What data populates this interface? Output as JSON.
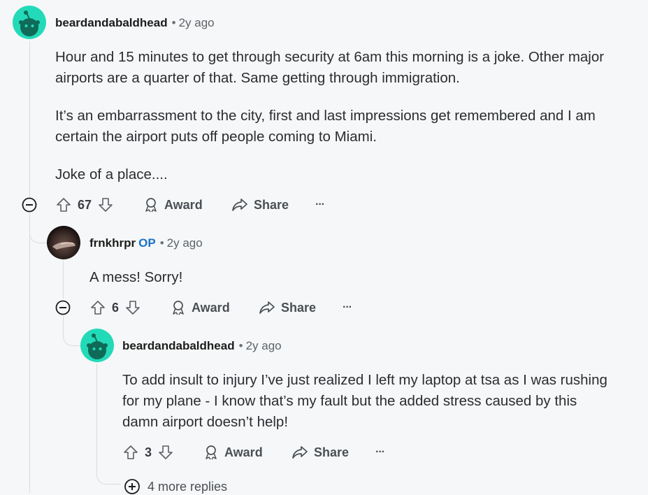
{
  "comments": [
    {
      "username": "beardandabaldhead",
      "op_badge": "",
      "separator": "•",
      "time": "2y ago",
      "paragraphs": [
        "Hour and 15 minutes to get through security at 6am this morning is a joke. Other major airports are a quarter of that. Same getting through immigration.",
        "It’s an embarrassment to the city, first and last impressions get remembered and I am certain the airport puts off people coming to Miami.",
        "Joke of a place...."
      ],
      "votes": "67",
      "award_label": "Award",
      "share_label": "Share",
      "more_label": "···"
    },
    {
      "username": "frnkhrpr",
      "op_badge": "OP",
      "separator": "•",
      "time": "2y ago",
      "paragraphs": [
        "A mess! Sorry!"
      ],
      "votes": "6",
      "award_label": "Award",
      "share_label": "Share",
      "more_label": "···"
    },
    {
      "username": "beardandabaldhead",
      "op_badge": "",
      "separator": "•",
      "time": "2y ago",
      "paragraphs": [
        "To add insult to injury I’ve just realized I left my laptop at tsa as I was rushing for my plane - I know that’s my fault but the added stress caused by this damn airport doesn’t help!"
      ],
      "votes": "3",
      "award_label": "Award",
      "share_label": "Share",
      "more_label": "···"
    }
  ],
  "more_replies": "4 more replies",
  "colors": {
    "background": "#f6f7f8",
    "snoo_avatar": "#23dab8",
    "op_badge": "#1a73c7",
    "thread_line": "#d9dbdd"
  },
  "icons": [
    "snoo-avatar-icon",
    "upvote-icon",
    "downvote-icon",
    "award-icon",
    "share-icon",
    "collapse-icon",
    "expand-icon"
  ]
}
